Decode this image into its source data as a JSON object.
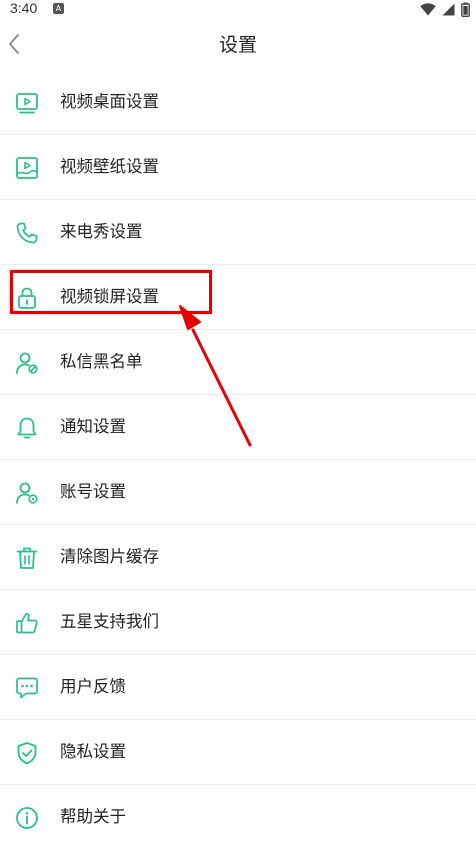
{
  "status_bar": {
    "time": "3:40",
    "notification_badge": "A"
  },
  "header": {
    "title": "设置",
    "back_icon": "chevron-left-icon"
  },
  "settings": [
    {
      "label": "视频桌面设置",
      "icon": "video-desktop-icon"
    },
    {
      "label": "视频壁纸设置",
      "icon": "video-wallpaper-icon"
    },
    {
      "label": "来电秀设置",
      "icon": "phone-icon"
    },
    {
      "label": "视频锁屏设置",
      "icon": "lock-icon"
    },
    {
      "label": "私信黑名单",
      "icon": "user-block-icon"
    },
    {
      "label": "通知设置",
      "icon": "bell-icon"
    },
    {
      "label": "账号设置",
      "icon": "user-settings-icon"
    },
    {
      "label": "清除图片缓存",
      "icon": "trash-icon"
    },
    {
      "label": "五星支持我们",
      "icon": "thumbs-up-icon"
    },
    {
      "label": "用户反馈",
      "icon": "chat-icon"
    },
    {
      "label": "隐私设置",
      "icon": "shield-check-icon"
    },
    {
      "label": "帮助关于",
      "icon": "info-icon"
    }
  ],
  "annotation": {
    "highlighted_item": "视频锁屏设置",
    "color": "#e60000"
  },
  "colors": {
    "accent": "#2bbf8a",
    "annotation": "#e60000"
  }
}
